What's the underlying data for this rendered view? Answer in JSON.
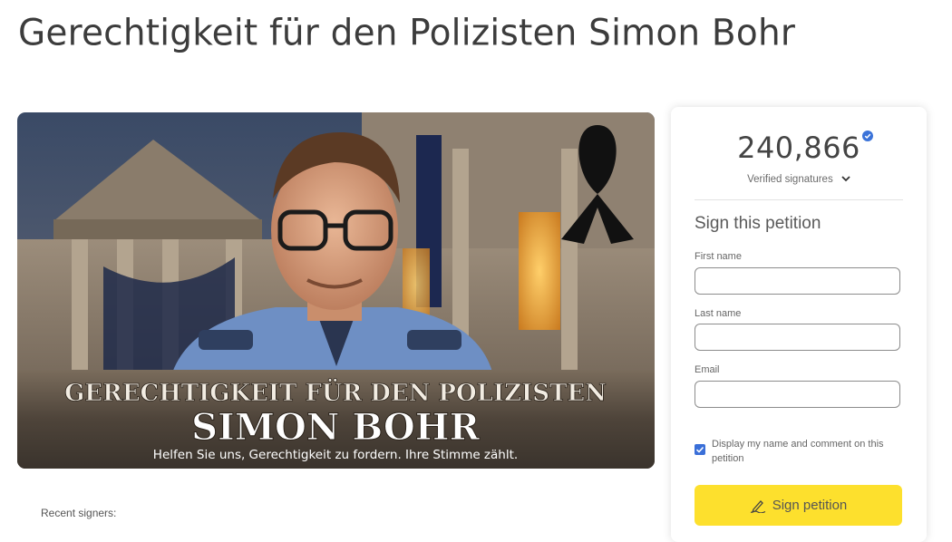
{
  "page": {
    "title": "Gerechtigkeit für den Polizisten Simon Bohr"
  },
  "hero": {
    "headline_line1": "GERECHTIGKEIT FÜR DEN POLIZISTEN",
    "headline_line2": "SIMON BOHR",
    "tagline": "Helfen Sie uns, Gerechtigkeit zu fordern. Ihre Stimme zählt."
  },
  "recent_signers": {
    "label": "Recent signers:"
  },
  "signature_card": {
    "count": "240,866",
    "verified_label": "Verified signatures",
    "heading": "Sign this petition",
    "first_name_label": "First name",
    "first_name_value": "",
    "last_name_label": "Last name",
    "last_name_value": "",
    "email_label": "Email",
    "email_value": "",
    "consent_label": "Display my name and comment on this petition",
    "consent_checked": true,
    "sign_button_label": "Sign petition",
    "icons": {
      "verified": "verified-check-icon",
      "chevron": "chevron-down-icon",
      "pen": "signature-pen-icon",
      "checkbox": "checkmark-icon"
    },
    "colors": {
      "button": "#fde02d",
      "checkbox": "#3a6fd8",
      "verified": "#3b73d9"
    }
  }
}
